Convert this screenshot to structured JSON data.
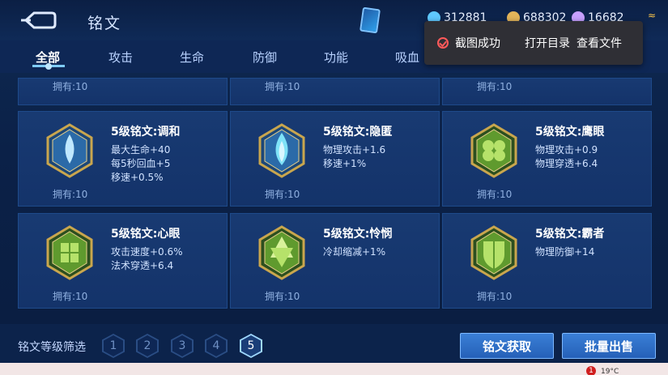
{
  "header": {
    "title": "铭文",
    "currency": [
      {
        "value": "312881",
        "color": "#5fc9ff",
        "icon": "diamond-icon"
      },
      {
        "value": "688302",
        "color": "#e2b45a",
        "icon": "gold-coin-icon"
      },
      {
        "value": "16682",
        "color": "#c7a0ff",
        "icon": "crystal-icon"
      }
    ]
  },
  "toast": {
    "status": "截图成功",
    "open_dir": "打开目录",
    "view_file": "查看文件"
  },
  "tabs": [
    "全部",
    "攻击",
    "生命",
    "防御",
    "功能",
    "吸血"
  ],
  "owned_label": "拥有:10",
  "runes": [
    {
      "name": "5级铭文:调和",
      "stats": [
        "最大生命+40",
        "每5秒回血+5",
        "移速+0.5%"
      ],
      "owned": "拥有:10",
      "color": "#7ec6f0",
      "icon": "teardrop-rune-icon"
    },
    {
      "name": "5级铭文:隐匿",
      "stats": [
        "物理攻击+1.6",
        "移速+1%"
      ],
      "owned": "拥有:10",
      "color": "#6fd4f2",
      "icon": "flame-rune-icon"
    },
    {
      "name": "5级铭文:鹰眼",
      "stats": [
        "物理攻击+0.9",
        "物理穿透+6.4"
      ],
      "owned": "拥有:10",
      "color": "#8bc84a",
      "icon": "clover-rune-icon"
    },
    {
      "name": "5级铭文:心眼",
      "stats": [
        "攻击速度+0.6%",
        "法术穿透+6.4"
      ],
      "owned": "拥有:10",
      "color": "#8bc84a",
      "icon": "leaf-rune-icon"
    },
    {
      "name": "5级铭文:怜悯",
      "stats": [
        "冷却缩减+1%"
      ],
      "owned": "拥有:10",
      "color": "#8bc84a",
      "icon": "star-rune-icon"
    },
    {
      "name": "5级铭文:霸者",
      "stats": [
        "物理防御+14"
      ],
      "owned": "拥有:10",
      "color": "#8bc84a",
      "icon": "shield-rune-icon"
    }
  ],
  "filter": {
    "label": "铭文等级筛选",
    "levels": [
      "1",
      "2",
      "3",
      "4",
      "5"
    ],
    "selected": "5"
  },
  "buttons": {
    "acquire": "铭文获取",
    "bulk_sell": "批量出售"
  },
  "taskbar": {
    "notification_count": "1",
    "temperature": "19°C"
  }
}
